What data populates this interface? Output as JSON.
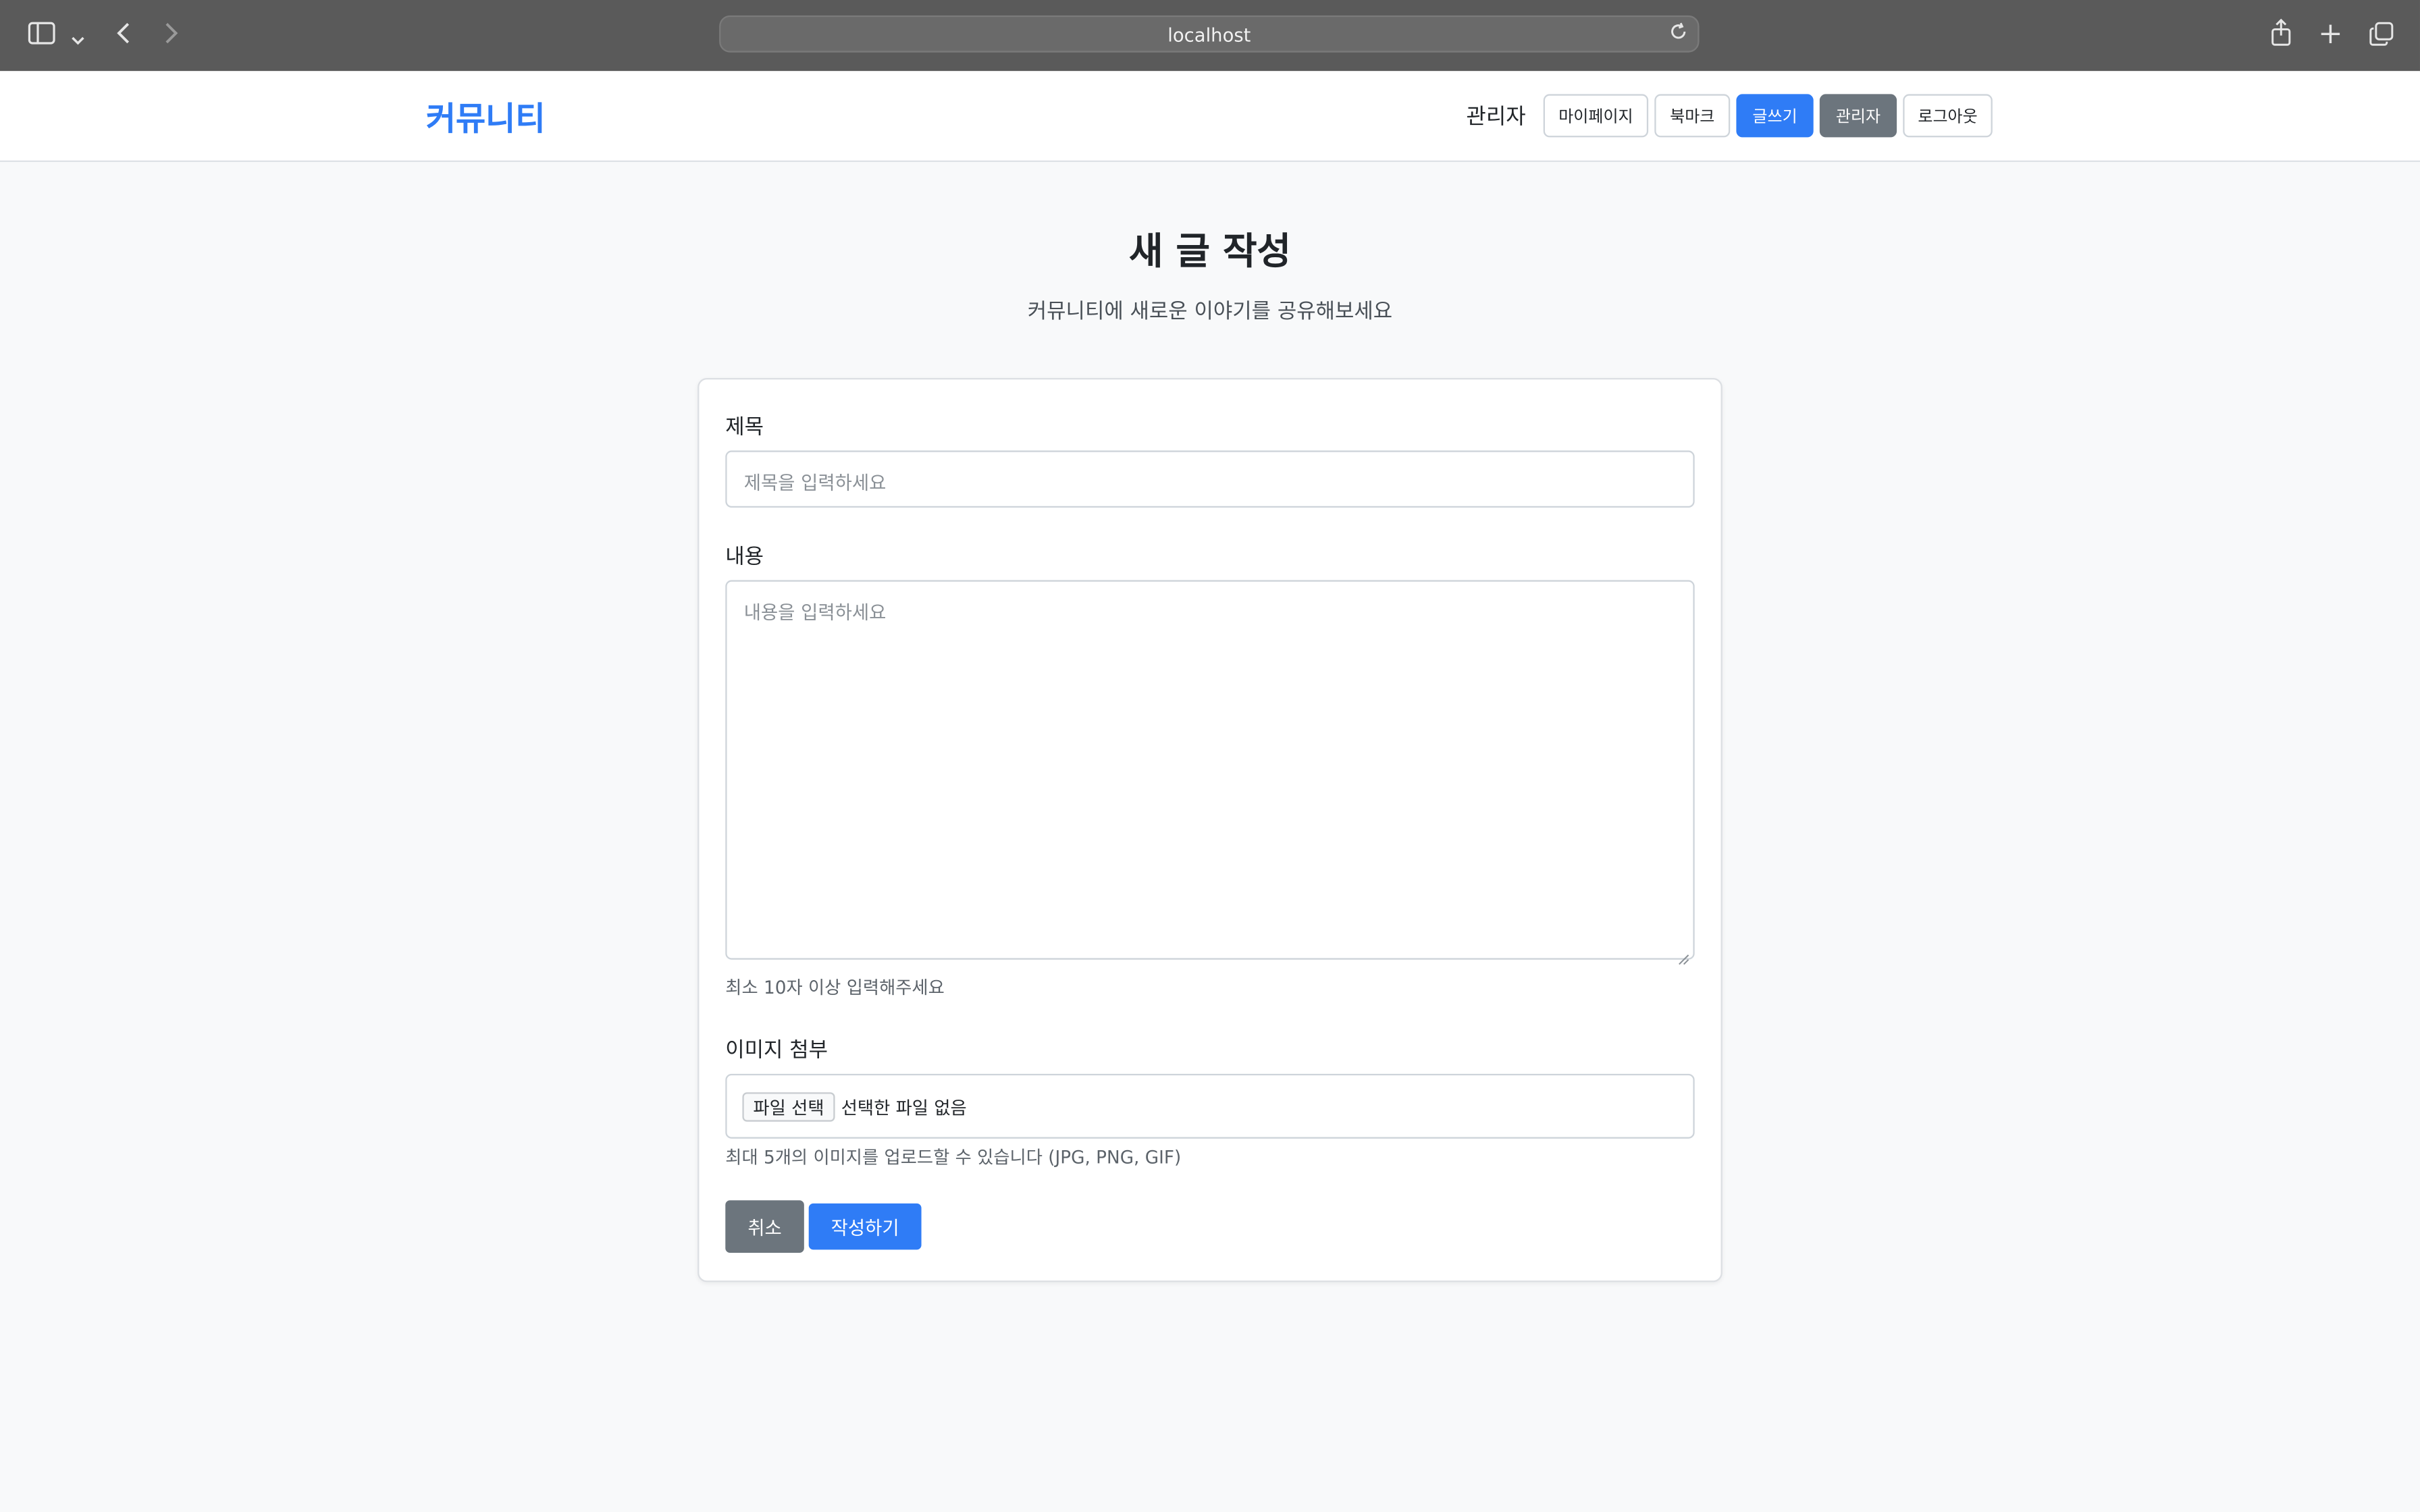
{
  "browser": {
    "url": "localhost",
    "icons": [
      "sidebar-icon",
      "chevron-down-icon",
      "back-icon",
      "forward-icon",
      "reload-icon",
      "share-icon",
      "new-tab-icon",
      "tabs-overview-icon"
    ]
  },
  "navbar": {
    "brand": "커뮤니티",
    "user_name": "관리자",
    "buttons": {
      "mypage": "마이페이지",
      "bookmark": "북마크",
      "write": "글쓰기",
      "admin": "관리자",
      "logout": "로그아웃"
    }
  },
  "header": {
    "title": "새 글 작성",
    "subtitle": "커뮤니티에 새로운 이야기를 공유해보세요"
  },
  "form": {
    "title_label": "제목",
    "title_placeholder": "제목을 입력하세요",
    "title_value": "",
    "content_label": "내용",
    "content_placeholder": "내용을 입력하세요",
    "content_value": "",
    "content_help": "최소 10자 이상 입력해주세요",
    "image_label": "이미지 첨부",
    "file_button": "파일 선택",
    "file_status": "선택한 파일 없음",
    "image_help": "최대 5개의 이미지를 업로드할 수 있습니다 (JPG, PNG, GIF)",
    "cancel_label": "취소",
    "submit_label": "작성하기"
  },
  "colors": {
    "primary": "#2f7cf6",
    "secondary": "#6c757d",
    "background": "#f8f9fa"
  }
}
